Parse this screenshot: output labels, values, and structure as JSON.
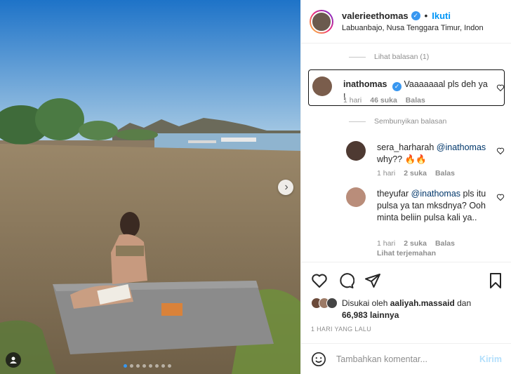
{
  "post": {
    "username": "valerieethomas",
    "follow_label": "Ikuti",
    "location": "Labuanbajo, Nusa Tenggara Timur, Indon"
  },
  "comments": {
    "view_replies": "Lihat balasan (1)",
    "hide_replies": "Sembunyikan balasan",
    "items": [
      {
        "username": "inathomas",
        "verified": true,
        "text": "Vaaaaaaal pls deh ya !",
        "time": "1 hari",
        "likes": "46 suka",
        "reply_label": "Balas"
      },
      {
        "username": "sera_harharah",
        "mention": "@inathomas",
        "text": "why?? 🔥🔥",
        "time": "1 hari",
        "likes": "2 suka",
        "reply_label": "Balas"
      },
      {
        "username": "theyufar",
        "mention": "@inathomas",
        "text": "pls itu pulsa ya tan mksdnya? Ooh minta beliin pulsa kali ya..",
        "time": "1 hari",
        "likes": "2 suka",
        "reply_label": "Balas",
        "translate_label": "Lihat terjemahan"
      }
    ]
  },
  "likes": {
    "prefix": "Disukai oleh",
    "user": "aaliyah.massaid",
    "and": "dan",
    "others": "66,983 lainnya"
  },
  "date": "1 HARI YANG LALU",
  "add_comment": {
    "placeholder": "Tambahkan komentar...",
    "send_label": "Kirim"
  },
  "colors": {
    "accent": "#0095f6",
    "verified": "#3897f0",
    "send_disabled": "#b2dffc",
    "muted": "#8e8e8e"
  }
}
